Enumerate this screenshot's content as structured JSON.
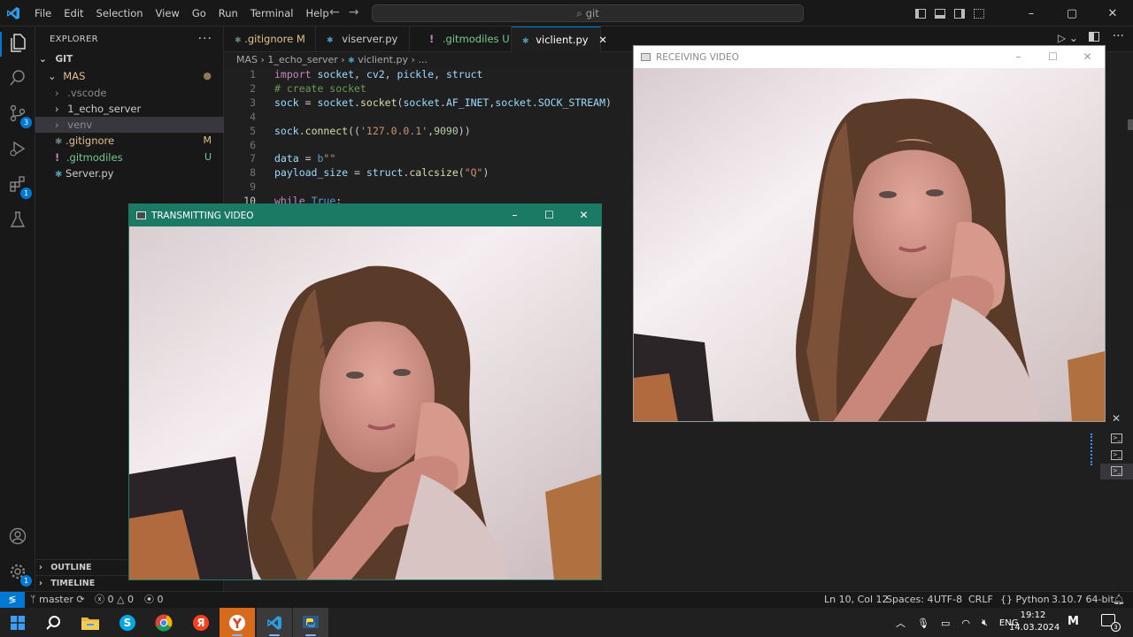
{
  "titlebar": {
    "menu": [
      "File",
      "Edit",
      "Selection",
      "View",
      "Go",
      "Run",
      "Terminal",
      "Help"
    ],
    "search": "git"
  },
  "explorer": {
    "title": "EXPLORER",
    "section": "GIT",
    "folder": "MAS",
    "items": [
      {
        "label": ".vscode",
        "status": ""
      },
      {
        "label": "1_echo_server",
        "status": ""
      },
      {
        "label": "venv",
        "status": ""
      },
      {
        "label": ".gitignore",
        "status": "M"
      },
      {
        "label": ".gitmodiles",
        "status": "U"
      },
      {
        "label": "Server.py",
        "status": ""
      }
    ],
    "outline": "OUTLINE",
    "timeline": "TIMELINE"
  },
  "activity_badges": {
    "scm": "3",
    "extensions": "1",
    "settings": "1"
  },
  "tabs": [
    {
      "label": ".gitignore",
      "status": "M"
    },
    {
      "label": "viserver.py",
      "status": ""
    },
    {
      "label": ".gitmodiles",
      "status": "U"
    },
    {
      "label": "viclient.py",
      "status": ""
    }
  ],
  "breadcrumb": [
    "MAS",
    "1_echo_server",
    "viclient.py",
    "..."
  ],
  "code": {
    "line_numbers": [
      "1",
      "2",
      "3",
      "4",
      "5",
      "6",
      "7",
      "8",
      "9",
      "10"
    ]
  },
  "windows": {
    "transmit_title": "TRANSMITTING VIDEO",
    "receive_title": "RECEIVING VIDEO"
  },
  "statusbar": {
    "branch": "master",
    "errors": "0",
    "warnings": "0",
    "ports": "0",
    "position": "Ln 10, Col 12",
    "spaces": "Spaces: 4",
    "encoding": "UTF-8",
    "eol": "CRLF",
    "language": "Python",
    "interpreter": "3.10.7 64-bit"
  },
  "taskbar": {
    "lang": "ENG",
    "time": "19:12",
    "date": "14.03.2024",
    "notif": "3"
  },
  "colors": {
    "accent": "#0078d4",
    "transmit_titlebar": "#1a7a63",
    "receive_titlebar": "#ffffff"
  }
}
